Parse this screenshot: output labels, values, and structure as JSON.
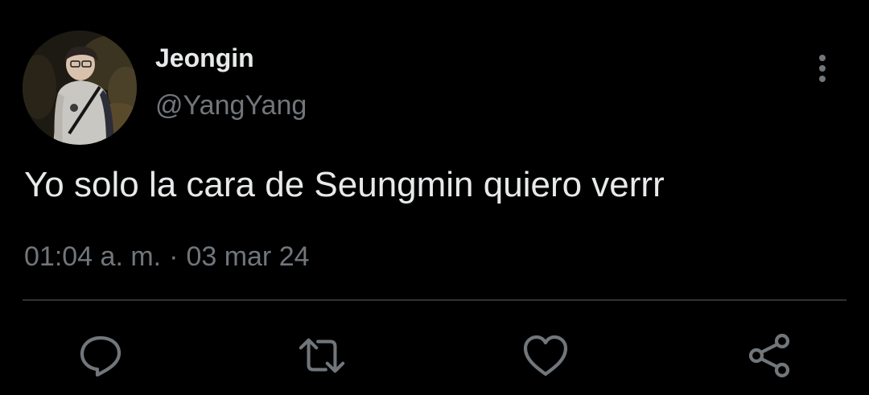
{
  "tweet": {
    "author": {
      "display_name": "Jeongin",
      "handle": "@YangYang",
      "avatar": "profile-photo"
    },
    "text": "Yo solo la cara de Seungmin quiero verrr",
    "time": "01:04 a. m.",
    "separator": "·",
    "date": "03 mar 24",
    "more_icon": "more-vertical-icon"
  },
  "actions": {
    "reply_icon": "reply-icon",
    "retweet_icon": "retweet-icon",
    "like_icon": "heart-icon",
    "share_icon": "share-icon"
  },
  "colors": {
    "background": "#000000",
    "primary_text": "#e7e9ea",
    "secondary_text": "#71767b",
    "divider": "#2f3336"
  }
}
